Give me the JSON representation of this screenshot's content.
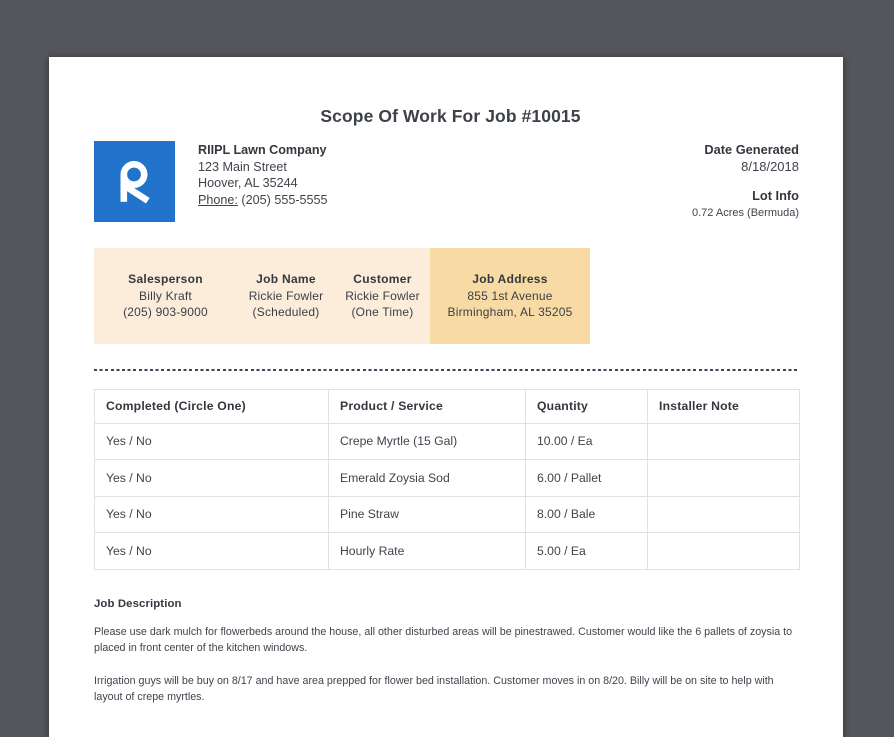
{
  "document": {
    "title": "Scope Of Work For Job #10015",
    "company": {
      "name": "RIIPL Lawn Company",
      "address_line1": "123 Main Street",
      "address_line2": "Hoover, AL 35244",
      "phone_label": "Phone:",
      "phone_number": "(205) 555-5555"
    },
    "meta": {
      "date_generated_label": "Date Generated",
      "date_generated": "8/18/2018",
      "lot_info_label": "Lot Info",
      "lot_info": "0.72 Acres (Bermuda)"
    },
    "banner": {
      "columns": [
        {
          "label": "Salesperson",
          "line1": "Billy Kraft",
          "line2": "(205) 903-9000",
          "highlighted": false
        },
        {
          "label": "Job Name",
          "line1": "Rickie Fowler",
          "line2": "(Scheduled)",
          "highlighted": false
        },
        {
          "label": "Customer",
          "line1": "Rickie Fowler",
          "line2": "(One Time)",
          "highlighted": false
        },
        {
          "label": "Job Address",
          "line1": "855 1st Avenue",
          "line2": "Birmingham, AL 35205",
          "highlighted": true
        }
      ]
    },
    "work_table": {
      "headers": [
        "Completed (Circle One)",
        "Product / Service",
        "Quantity",
        "Installer Note"
      ],
      "rows": [
        [
          "Yes / No",
          "Crepe Myrtle (15 Gal)",
          "10.00 / Ea",
          ""
        ],
        [
          "Yes / No",
          "Emerald Zoysia Sod",
          "6.00 / Pallet",
          ""
        ],
        [
          "Yes / No",
          "Pine Straw",
          "8.00 / Bale",
          ""
        ],
        [
          "Yes / No",
          "Hourly Rate",
          "5.00 / Ea",
          ""
        ]
      ]
    },
    "job_description": {
      "heading": "Job Description",
      "paragraphs": [
        "Please use dark mulch for flowerbeds around the house, all other disturbed areas will be pinestrawed. Customer would like the 6 pallets of zoysia to placed in front center of the kitchen windows.",
        "Irrigation guys will be buy on 8/17 and have area prepped for flower bed installation. Customer moves in on 8/20. Billy will be on site to help with layout of crepe myrtles."
      ]
    },
    "logo": {
      "letter": "R"
    },
    "colors": {
      "canvas_background": "#54565b",
      "logo_blue": "#2173cc",
      "banner_background": "#fbedda",
      "banner_highlight": "#f8dba4",
      "text": "#3f444c"
    }
  }
}
